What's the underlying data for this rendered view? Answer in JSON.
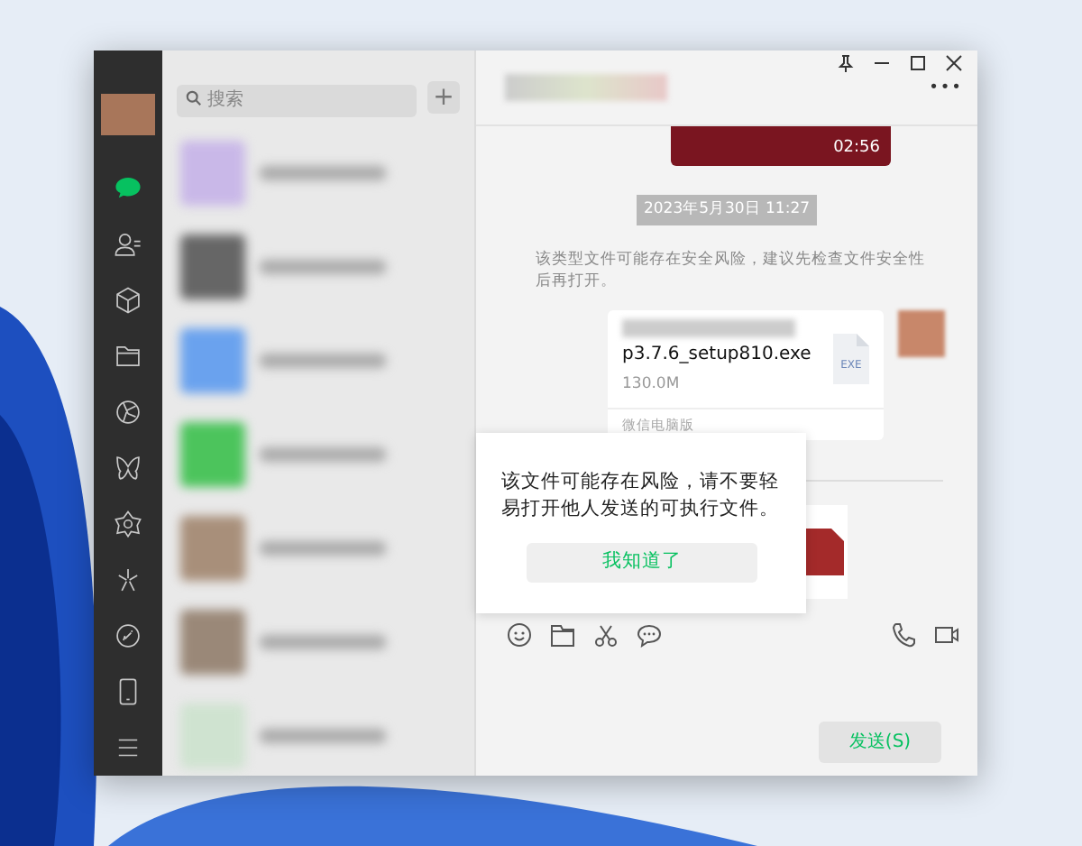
{
  "sidebar": {
    "items": [
      {
        "kind": "chats",
        "selected": true
      },
      {
        "kind": "contacts",
        "selected": false
      },
      {
        "kind": "cube",
        "selected": false
      },
      {
        "kind": "folder",
        "selected": false
      },
      {
        "kind": "aperture",
        "selected": false
      },
      {
        "kind": "butterfly",
        "selected": false
      },
      {
        "kind": "flower",
        "selected": false
      },
      {
        "kind": "spark",
        "selected": false
      }
    ],
    "bottom_items": [
      {
        "kind": "link"
      },
      {
        "kind": "phone"
      },
      {
        "kind": "menu"
      }
    ]
  },
  "search": {
    "placeholder": "搜索",
    "add_button": "+"
  },
  "chat": {
    "more": "•••",
    "video": {
      "duration": "02:56"
    },
    "timestamp": "2023年5月30日 11:27",
    "notice": "该类型文件可能存在安全风险，建议先检查文件安全性后再打开。",
    "file": {
      "name": "p3.7.6_setup810.exe",
      "size": "130.0M",
      "type": "EXE",
      "source": "微信电脑版"
    }
  },
  "popup": {
    "message": "该文件可能存在风险，请不要轻易打开他人发送的可执行文件。",
    "button": "我知道了"
  },
  "send_button": "发送(S)"
}
